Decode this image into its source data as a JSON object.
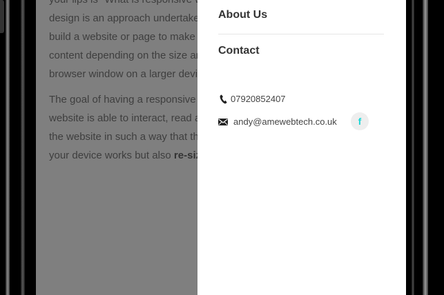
{
  "page": {
    "paragraphs": [
      [
        "your lips is \"What is responsive w",
        "design is an approach undertake",
        "build a website or page to make",
        "content depending on the size ar",
        "browser window on a larger devi"
      ],
      [
        "The goal of having a responsive",
        "website is able to interact, read a",
        "the website in such a way that th"
      ]
    ],
    "last_line_text": "your device works but also ",
    "last_line_bold": "re-siz"
  },
  "menu": {
    "items": [
      {
        "label": "About Us"
      },
      {
        "label": "Contact"
      }
    ]
  },
  "contact": {
    "phone": "07920852407",
    "email": "andy@amewebtech.co.uk",
    "facebook_glyph": "f",
    "facebook_color": "#1fd6d6"
  },
  "colors": {
    "overlay": "#7f7f7f",
    "panel": "#ffffff",
    "frame": "#000000"
  }
}
